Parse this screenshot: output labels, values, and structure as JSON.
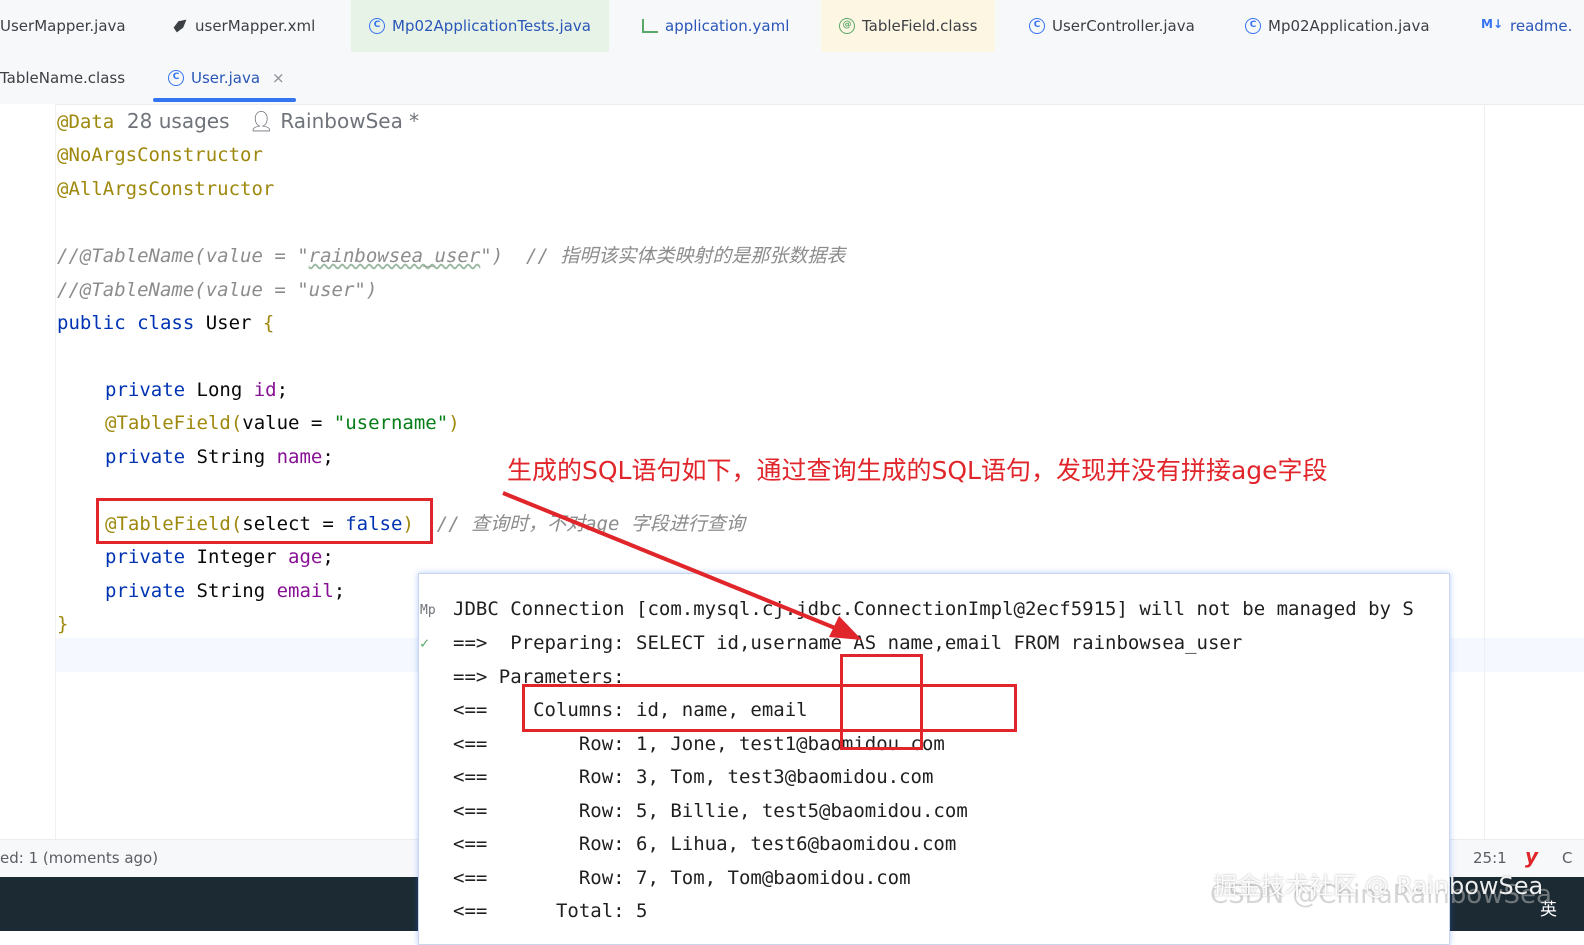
{
  "tabs_row1": [
    {
      "label": "UserMapper.java",
      "icon": "interface-icon"
    },
    {
      "label": "userMapper.xml",
      "icon": "mybatis-bird-icon"
    },
    {
      "label": "Mp02ApplicationTests.java",
      "icon": "test-class-icon"
    },
    {
      "label": "application.yaml",
      "icon": "yaml-icon"
    },
    {
      "label": "TableField.class",
      "icon": "annotation-icon"
    },
    {
      "label": "UserController.java",
      "icon": "class-icon"
    },
    {
      "label": "Mp02Application.java",
      "icon": "spring-class-icon"
    },
    {
      "label": "readme.",
      "icon": "markdown-icon",
      "icon_text": "M↓"
    }
  ],
  "tabs_row2": [
    {
      "label": "TableName.class"
    },
    {
      "label": "User.java",
      "active": true,
      "close": "×"
    }
  ],
  "code": {
    "l1_ann": "@Data",
    "l1_usages": "28 usages",
    "l1_author": "RainbowSea *",
    "l2": "@NoArgsConstructor",
    "l3": "@AllArgsConstructor",
    "l5_pre": "//@TableName(value = \"",
    "l5_mid": "rainbowsea_user",
    "l5_post": "\")  // 指明该实体类映射的是那张数据表",
    "l6": "//@TableName(value = \"user\")",
    "l7_kw": "public class",
    "l7_name": " User ",
    "l7_brace": "{",
    "l9_kw": "private",
    "l9_type": " Long ",
    "l9_field": "id",
    "l9_end": ";",
    "l10_ann": "@TableField(",
    "l10_arg": "value = ",
    "l10_str": "\"username\"",
    "l10_close": ")",
    "l11_kw": "private",
    "l11_type": " String ",
    "l11_field": "name",
    "l11_end": ";",
    "l13_ann": "@TableField(",
    "l13_arg": "select = ",
    "l13_val": "false",
    "l13_close": ")",
    "l13_cmt": "// 查询时，不对age 字段进行查询",
    "l14_kw": "private",
    "l14_type": " Integer ",
    "l14_field": "age",
    "l14_end": ";",
    "l15_kw": "private",
    "l15_type": " String ",
    "l15_field": "email",
    "l15_end": ";",
    "l16": "}"
  },
  "console": {
    "gutter1": "Mp",
    "gutter2": "✓",
    "lines": [
      "JDBC Connection [com.mysql.cj.jdbc.ConnectionImpl@2ecf5915] will not be managed by S",
      "==>  Preparing: SELECT id,username AS name,email FROM rainbowsea_user",
      "==> Parameters: ",
      "<==    Columns: id, name, email",
      "<==        Row: 1, Jone, test1@baomidou.com",
      "<==        Row: 3, Tom, test3@baomidou.com",
      "<==        Row: 5, Billie, test5@baomidou.com",
      "<==        Row: 6, Lihua, test6@baomidou.com",
      "<==        Row: 7, Tom, Tom@baomidou.com",
      "<==      Total: 5"
    ]
  },
  "annotation_note": "生成的SQL语句如下，通过查询生成的SQL语句，发现并没有拼接age字段",
  "status": {
    "left": "ed: 1 (moments ago)",
    "position": "25:1",
    "icon": "y",
    "edge": "C"
  },
  "watermark": "掘金技术社区 @ RainbowSea",
  "watermark2": "CSDN @ChinaRainbowSea",
  "ime": "英",
  "colors": {
    "annotation_red": "#e0252b",
    "accent": "#3574f0"
  }
}
